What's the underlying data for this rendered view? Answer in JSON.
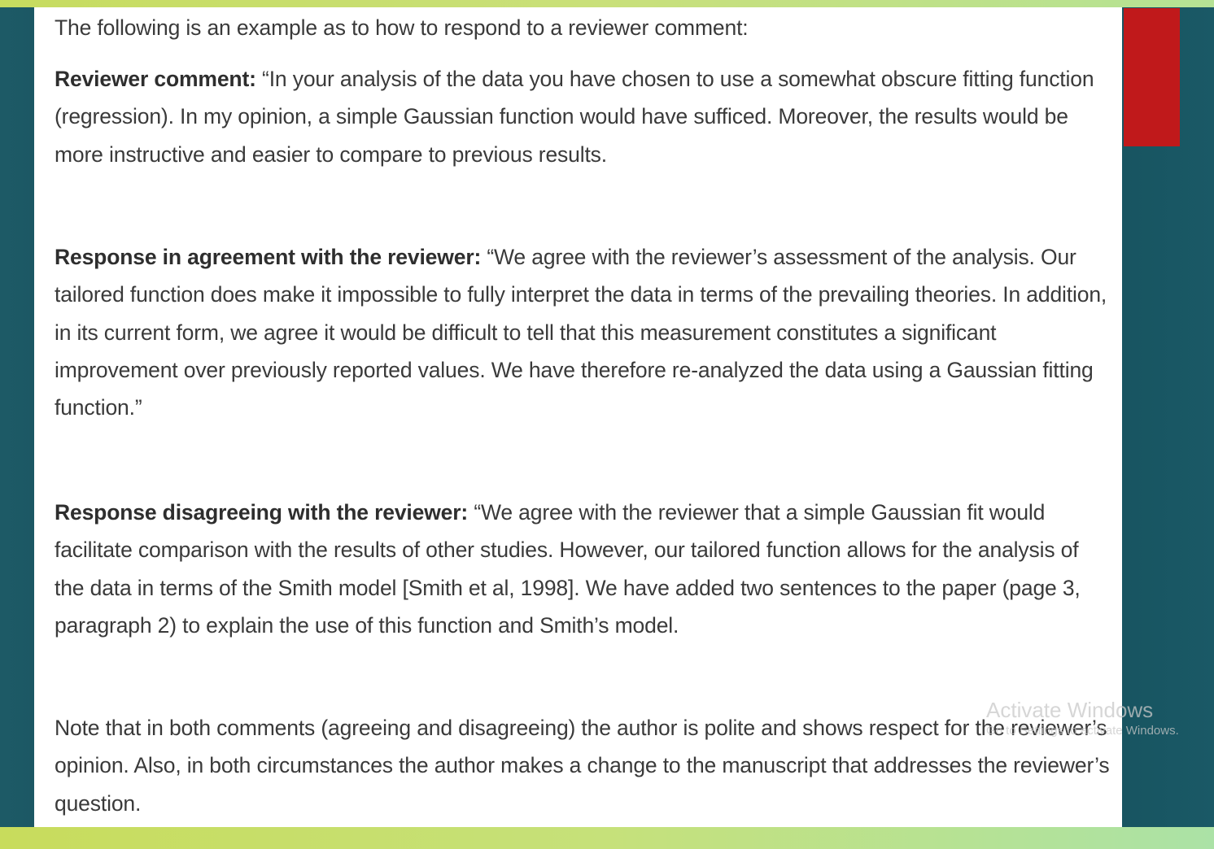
{
  "document": {
    "intro": "The following is an example as to how to respond to a reviewer comment:",
    "reviewer_comment": {
      "label": "Reviewer comment:",
      "text": " “In your analysis of the data you have chosen to use a somewhat obscure fitting function (regression). In my opinion, a simple Gaussian function would have sufficed. Moreover, the results would be more instructive and easier to compare to previous results."
    },
    "response_agree": {
      "label": "Response in agreement with the reviewer:",
      "text": " “We agree with the reviewer’s assessment of the analysis. Our tailored function does make it impossible to fully interpret the data in terms of the prevailing theories. In addition, in its current form, we agree it would be difficult to tell that this measurement constitutes a significant improvement over previously reported values. We have therefore re-analyzed the data using a Gaussian fitting function.”"
    },
    "response_disagree": {
      "label": "Response disagreeing with the reviewer:",
      "text": " “We agree with the reviewer that a simple Gaussian fit would facilitate comparison with the results of other studies. However, our tailored function allows for the analysis of the data in terms of the Smith model [Smith et al, 1998]. We have added two sentences to the paper (page 3, paragraph 2) to explain the use of this function and Smith’s model."
    },
    "note": "Note that in both comments (agreeing and disagreeing) the author is polite and shows respect for the reviewer’s opinion. Also, in both circumstances the author makes a change to the manuscript that addresses the reviewer’s question."
  },
  "watermark": {
    "title": "Activate Windows",
    "subtitle": "Go to Settings to activate Windows."
  },
  "colors": {
    "background": "#17505d",
    "accent_strip": "#c8dc5c",
    "red_block": "#c0191b",
    "page": "#ffffff",
    "text": "#3a3a3a"
  }
}
